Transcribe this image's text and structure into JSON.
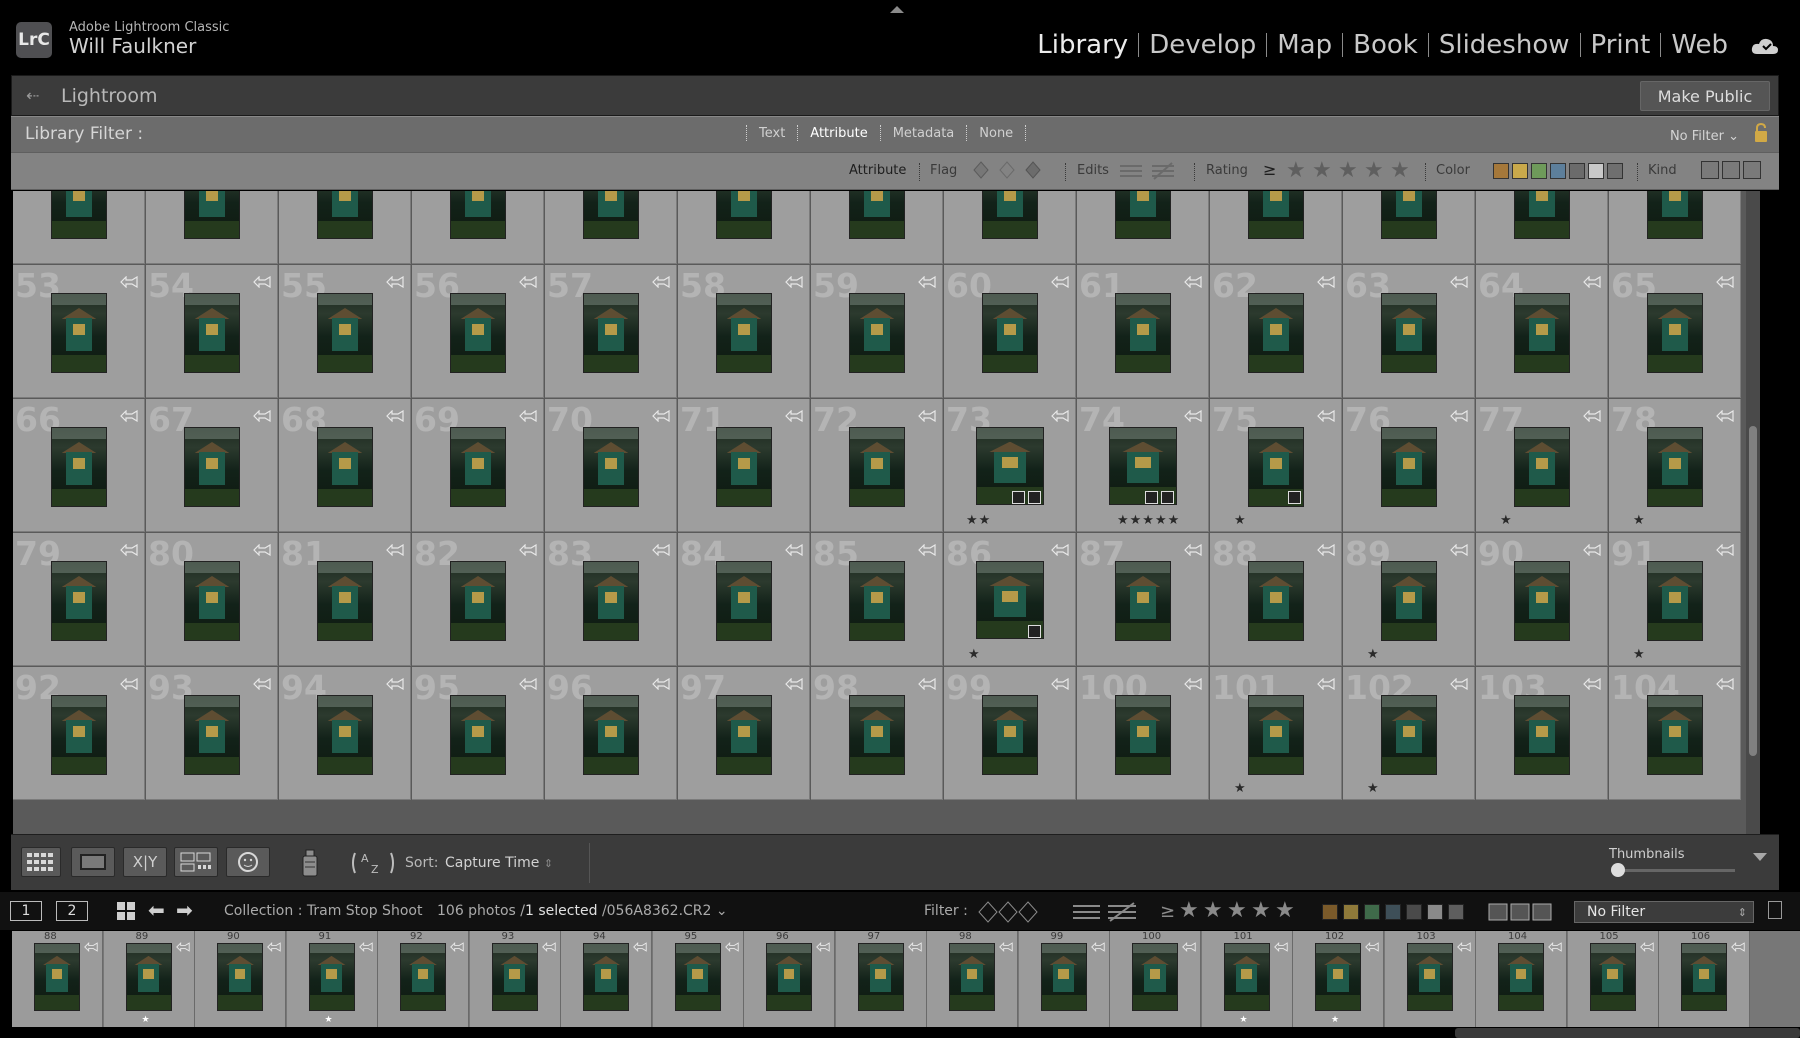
{
  "app": {
    "app_name": "Adobe Lightroom Classic",
    "user_name": "Will Faulkner",
    "logo": "LrC"
  },
  "modules": [
    "Library",
    "Develop",
    "Map",
    "Book",
    "Slideshow",
    "Print",
    "Web"
  ],
  "active_module": "Library",
  "header": {
    "title": "Lightroom",
    "make_public": "Make Public"
  },
  "library_filter": {
    "label": "Library Filter :",
    "tabs": [
      "Text",
      "Attribute",
      "Metadata",
      "None"
    ],
    "active_tab": "Attribute",
    "preset": "No Filter"
  },
  "attribute_bar": {
    "attribute": "Attribute",
    "flag": "Flag",
    "edits": "Edits",
    "rating": "Rating",
    "rating_op": "≥",
    "color": "Color",
    "kind": "Kind",
    "color_swatches": [
      "#a5783a",
      "#c9a94b",
      "#6e9a5a",
      "#5d7f9b",
      "#6b6b6b",
      "#c9c9c9",
      "#6f6f6f"
    ]
  },
  "grid": {
    "rows": [
      {
        "label": "",
        "cells": [
          {
            "num": "",
            "stars": 0
          },
          {
            "num": "",
            "stars": 0
          },
          {
            "num": "",
            "stars": 0
          },
          {
            "num": "",
            "stars": 0
          },
          {
            "num": "",
            "stars": 0
          },
          {
            "num": "",
            "stars": 0
          },
          {
            "num": "",
            "stars": 0
          },
          {
            "num": "",
            "stars": 0
          },
          {
            "num": "",
            "stars": 0
          },
          {
            "num": "",
            "stars": 0
          },
          {
            "num": "",
            "stars": 0
          },
          {
            "num": "",
            "stars": 0
          },
          {
            "num": "",
            "stars": 0
          }
        ]
      },
      {
        "label": "53",
        "cells": [
          {
            "num": "53",
            "stars": 0
          },
          {
            "num": "54",
            "stars": 0
          },
          {
            "num": "55",
            "stars": 0
          },
          {
            "num": "56",
            "stars": 0
          },
          {
            "num": "57",
            "stars": 0
          },
          {
            "num": "58",
            "stars": 0
          },
          {
            "num": "59",
            "stars": 0
          },
          {
            "num": "60",
            "stars": 0
          },
          {
            "num": "61",
            "stars": 0
          },
          {
            "num": "62",
            "stars": 0
          },
          {
            "num": "63",
            "stars": 0
          },
          {
            "num": "64",
            "stars": 0
          },
          {
            "num": "65",
            "stars": 0
          }
        ]
      },
      {
        "label": "66",
        "cells": [
          {
            "num": "66",
            "stars": 0
          },
          {
            "num": "67",
            "stars": 0
          },
          {
            "num": "68",
            "stars": 0
          },
          {
            "num": "69",
            "stars": 0
          },
          {
            "num": "70",
            "stars": 0
          },
          {
            "num": "71",
            "stars": 0
          },
          {
            "num": "72",
            "stars": 0
          },
          {
            "num": "73",
            "stars": 2,
            "landscape": true,
            "badges": 2
          },
          {
            "num": "74",
            "stars": 5,
            "landscape": true,
            "badges": 2
          },
          {
            "num": "75",
            "stars": 1,
            "badges": 1
          },
          {
            "num": "76",
            "stars": 0
          },
          {
            "num": "77",
            "stars": 1
          },
          {
            "num": "78",
            "stars": 1
          }
        ]
      },
      {
        "label": "79",
        "cells": [
          {
            "num": "79",
            "stars": 0
          },
          {
            "num": "80",
            "stars": 0
          },
          {
            "num": "81",
            "stars": 0
          },
          {
            "num": "82",
            "stars": 0
          },
          {
            "num": "83",
            "stars": 0
          },
          {
            "num": "84",
            "stars": 0
          },
          {
            "num": "85",
            "stars": 0
          },
          {
            "num": "86",
            "stars": 1,
            "landscape": true,
            "badges": 1
          },
          {
            "num": "87",
            "stars": 0
          },
          {
            "num": "88",
            "stars": 0
          },
          {
            "num": "89",
            "stars": 1
          },
          {
            "num": "90",
            "stars": 0
          },
          {
            "num": "91",
            "stars": 1
          }
        ]
      },
      {
        "label": "92",
        "cells": [
          {
            "num": "92",
            "stars": 0
          },
          {
            "num": "93",
            "stars": 0
          },
          {
            "num": "94",
            "stars": 0
          },
          {
            "num": "95",
            "stars": 0
          },
          {
            "num": "96",
            "stars": 0
          },
          {
            "num": "97",
            "stars": 0
          },
          {
            "num": "98",
            "stars": 0
          },
          {
            "num": "99",
            "stars": 0
          },
          {
            "num": "100",
            "stars": 0
          },
          {
            "num": "101",
            "stars": 1
          },
          {
            "num": "102",
            "stars": 1
          },
          {
            "num": "103",
            "stars": 0
          },
          {
            "num": "104",
            "stars": 0
          }
        ]
      }
    ]
  },
  "toolbar": {
    "sort_label": "Sort:",
    "sort_value": "Capture Time",
    "thumbnails_label": "Thumbnails",
    "view_buttons": [
      "grid-view",
      "loupe-view",
      "compare-view",
      "survey-view",
      "people-view"
    ],
    "xy_label": "X|Y"
  },
  "filmstrip_header": {
    "screen1": "1",
    "screen2": "2",
    "collection": "Collection : Tram Stop Shoot",
    "count": "106 photos /",
    "selected": "1 selected",
    "file": "/056A8362.CR2",
    "filter_label": "Filter :",
    "filter_value": "No Filter",
    "swatches": [
      "#7a5a2a",
      "#8f7a3a",
      "#3f6a4a",
      "#3e4f58",
      "#4a4a4a",
      "#8a8a8a",
      "#5e5e5e"
    ]
  },
  "filmstrip": {
    "items": [
      {
        "num": "88",
        "star": false
      },
      {
        "num": "89",
        "star": true
      },
      {
        "num": "90",
        "star": false
      },
      {
        "num": "91",
        "star": true
      },
      {
        "num": "92",
        "star": false
      },
      {
        "num": "93",
        "star": false
      },
      {
        "num": "94",
        "star": false
      },
      {
        "num": "95",
        "star": false
      },
      {
        "num": "96",
        "star": false
      },
      {
        "num": "97",
        "star": false
      },
      {
        "num": "98",
        "star": false
      },
      {
        "num": "99",
        "star": false
      },
      {
        "num": "100",
        "star": false
      },
      {
        "num": "101",
        "star": true
      },
      {
        "num": "102",
        "star": true
      },
      {
        "num": "103",
        "star": false
      },
      {
        "num": "104",
        "star": false
      },
      {
        "num": "105",
        "star": false
      },
      {
        "num": "106",
        "star": false
      }
    ]
  }
}
